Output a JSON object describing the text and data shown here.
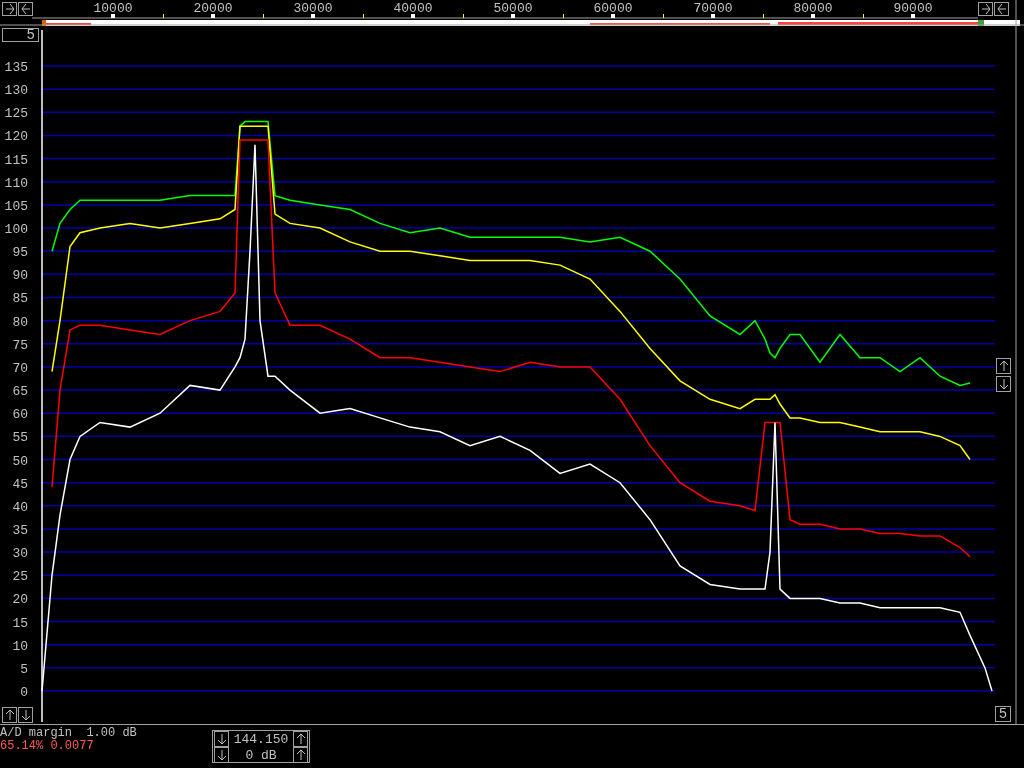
{
  "top_left_box": {
    "label": "5"
  },
  "chart": {
    "chart_data": {
      "type": "line",
      "x": [
        2900,
        3900,
        4700,
        5700,
        6700,
        8700,
        11700,
        14700,
        17700,
        20700,
        22200,
        22700,
        23200,
        23700,
        24200,
        24700,
        25500,
        26200,
        27700,
        30700,
        33700,
        36700,
        39700,
        42700,
        45700,
        48700,
        51700,
        54700,
        57700,
        60700,
        63700,
        66700,
        69700,
        72700,
        74200,
        75200,
        75700,
        76200,
        76700,
        77700,
        78700,
        80700,
        82700,
        84700,
        86700,
        88700,
        90700,
        92700,
        94700,
        95700,
        97200,
        97900
      ],
      "series": [
        {
          "color": "#00ff00",
          "values": [
            null,
            95,
            101,
            104,
            106,
            106,
            106,
            106,
            107,
            107,
            107,
            122,
            123,
            123,
            123,
            123,
            123,
            107,
            106,
            105,
            104,
            101,
            99,
            100,
            98,
            98,
            98,
            98,
            97,
            98,
            95,
            89,
            81,
            77,
            80,
            76,
            73,
            72,
            74,
            77,
            77,
            71,
            77,
            72,
            72,
            69,
            72,
            68,
            66,
            66.5,
            null,
            null
          ]
        },
        {
          "color": "#ffff00",
          "values": [
            null,
            69,
            80,
            96,
            99,
            100,
            101,
            100,
            101,
            102,
            104,
            122,
            122,
            122,
            122,
            122,
            122,
            103,
            101,
            100,
            97,
            95,
            95,
            94,
            93,
            93,
            93,
            92,
            89,
            82,
            74,
            67,
            63,
            61,
            63,
            63,
            63,
            64,
            62,
            59,
            59,
            58,
            58,
            57,
            56,
            56,
            56,
            55,
            53,
            50,
            null,
            null
          ]
        },
        {
          "color": "#ff0000",
          "values": [
            null,
            44,
            65,
            78,
            79,
            79,
            78,
            77,
            80,
            82,
            86,
            119,
            119,
            119,
            119,
            119,
            119,
            86,
            79,
            79,
            76,
            72,
            72,
            71,
            70,
            69,
            71,
            70,
            70,
            63,
            53,
            45,
            41,
            40,
            39,
            58,
            58,
            58,
            58,
            37,
            36,
            36,
            35,
            35,
            34,
            34,
            33.5,
            33.5,
            31,
            29,
            null,
            null
          ]
        },
        {
          "color": "#ffffff",
          "values": [
            0,
            25,
            38,
            50,
            55,
            58,
            57,
            60,
            66,
            65,
            70,
            72,
            76,
            95,
            118,
            80,
            68,
            68,
            65,
            60,
            61,
            59,
            57,
            56,
            53,
            55,
            52,
            47,
            49,
            45,
            37,
            27,
            23,
            22,
            22,
            22,
            30,
            58,
            22,
            20,
            20,
            20,
            19,
            19,
            18,
            18,
            18,
            18,
            17,
            12,
            5,
            0
          ]
        }
      ],
      "grid": true,
      "xlim": [
        2900,
        98200
      ],
      "ylim": [
        0,
        135
      ],
      "xticks": [
        10000,
        20000,
        30000,
        40000,
        50000,
        60000,
        70000,
        80000,
        90000
      ],
      "yticks": [
        0,
        5,
        10,
        15,
        20,
        25,
        30,
        35,
        40,
        45,
        50,
        55,
        60,
        65,
        70,
        75,
        80,
        85,
        90,
        95,
        100,
        105,
        110,
        115,
        120,
        125,
        130,
        135
      ]
    }
  },
  "right_box": {
    "label": "5"
  },
  "status": {
    "ad_margin": "A/D margin  1.00 dB",
    "stats": "65.14% 0.0077"
  },
  "gain_box": {
    "frequency": "144.150",
    "gain": "0 dB"
  }
}
